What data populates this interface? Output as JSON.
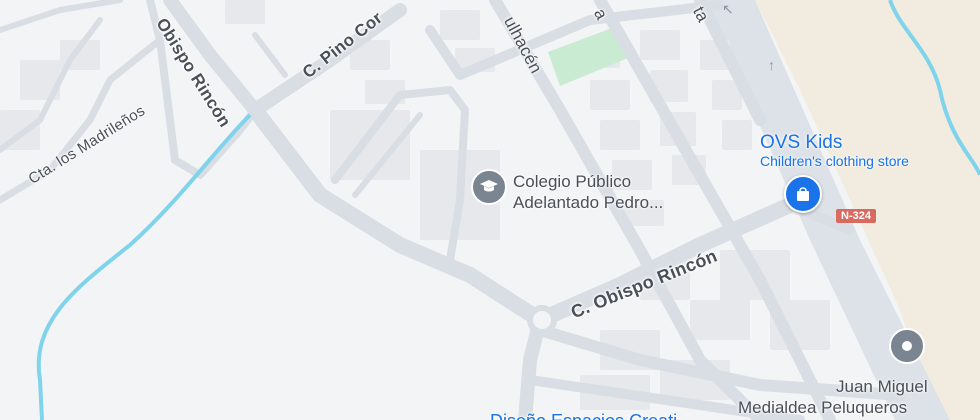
{
  "streets": {
    "obispo_rincon_vertical": "Obispo Rincón",
    "pino_corto": "C. Pino Cor",
    "madrilenos": "Cta. los Madrileños",
    "mulhacen": "ulhacén",
    "top_a": "a",
    "top_ta": "ta",
    "obispo_rincon_main": "C. Obispo Rincón"
  },
  "pois": {
    "colegio": {
      "icon": "school-icon",
      "line1": "Colegio Público",
      "line2": "Adelantado Pedro..."
    },
    "ovs": {
      "icon": "shopping-bag-icon",
      "title": "OVS Kids",
      "subtitle": "Children's clothing store"
    },
    "peluqueros": {
      "icon": "place-pin-icon",
      "line1": "Juan Miguel",
      "line2": "Medialdea Peluqueros"
    },
    "bottom_partial": "Diseño Espacios Creati"
  },
  "road_shield": "N-324",
  "colors": {
    "water": "#7fd3ea",
    "beach": "#f1ecdf",
    "road": "#dfe3e8",
    "road_edge": "#c9d0d8",
    "building": "#e9ebee",
    "park": "#c9ebd2",
    "poi_blue": "#1a73e8",
    "poi_gray": "#7a8591"
  }
}
